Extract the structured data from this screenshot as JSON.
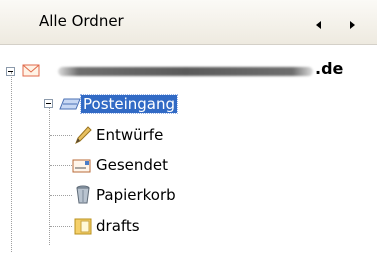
{
  "header": {
    "title": "Alle Ordner",
    "prev_arrow": "◂",
    "next_arrow": "▸"
  },
  "account": {
    "label_suffix": ".de"
  },
  "folders": [
    {
      "label": "Posteingang",
      "icon": "inbox-tray-icon",
      "selected": true
    },
    {
      "label": "Entwürfe",
      "icon": "pen-icon"
    },
    {
      "label": "Gesendet",
      "icon": "sent-envelope-icon"
    },
    {
      "label": "Papierkorb",
      "icon": "trash-bin-icon"
    },
    {
      "label": "drafts",
      "icon": "folder-icon"
    }
  ],
  "colors": {
    "selection": "#316ac5",
    "header_bg": "#f3f1eb"
  }
}
